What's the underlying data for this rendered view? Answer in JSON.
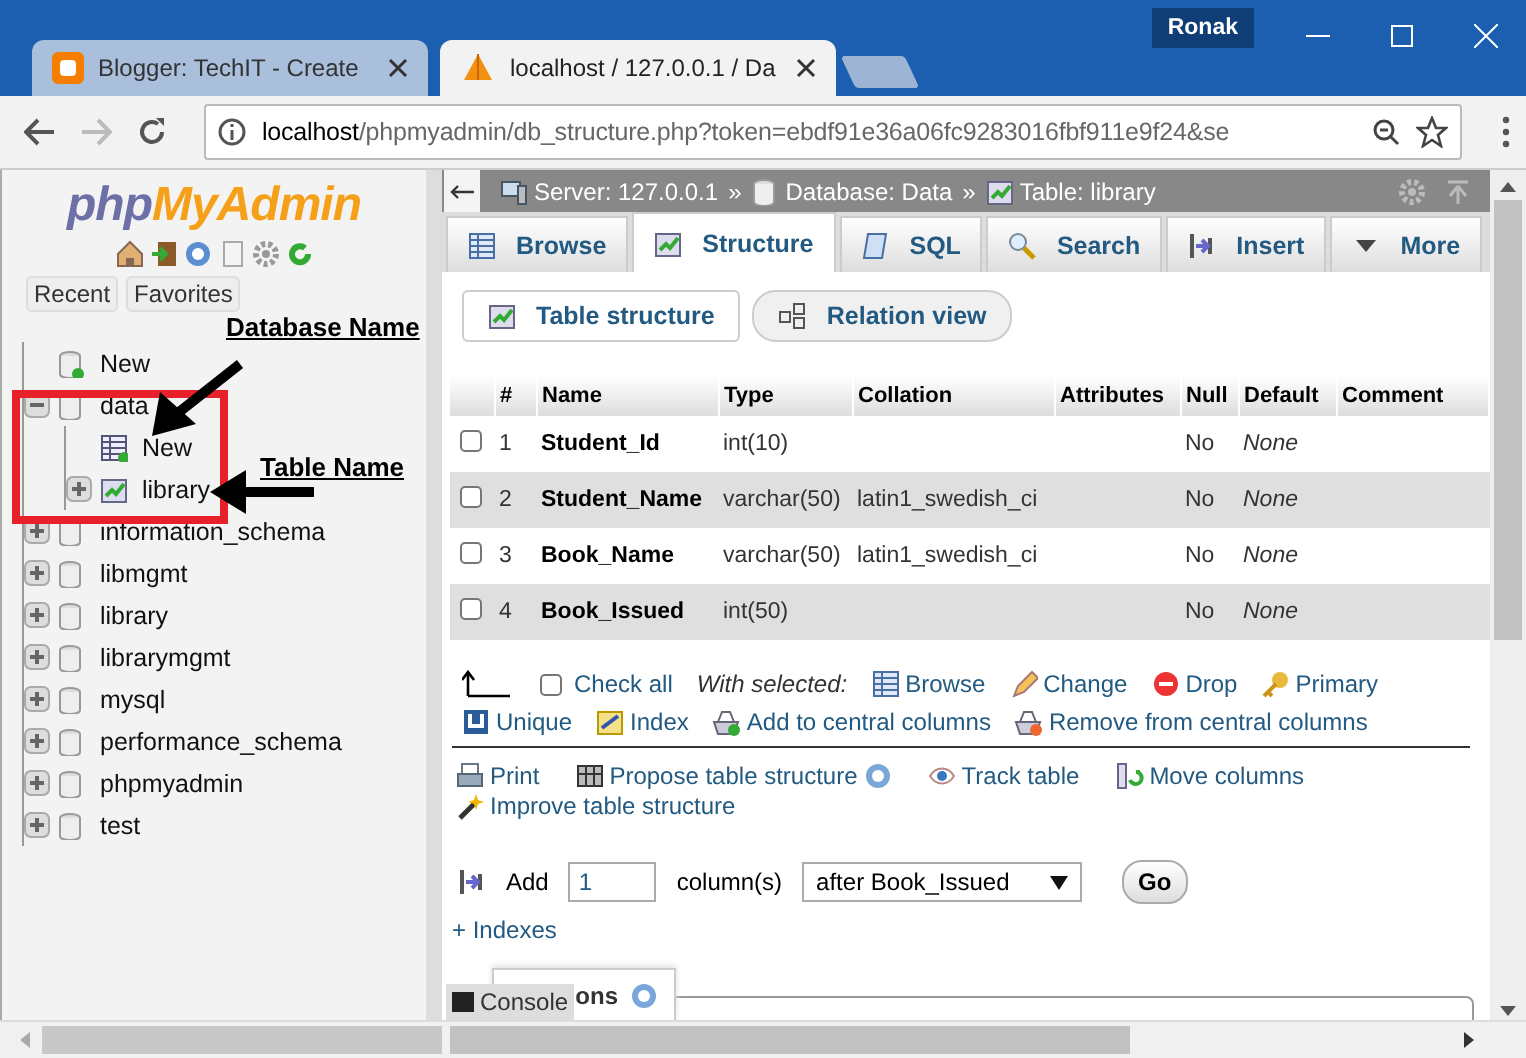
{
  "browser": {
    "tabs": [
      {
        "title": "Blogger: TechIT - Create",
        "kind": "blogger",
        "selected": false
      },
      {
        "title": "localhost / 127.0.0.1 / Da",
        "kind": "pma",
        "selected": true
      }
    ],
    "profile": "Ronak",
    "url": {
      "host": "localhost",
      "path": "/phpmyadmin/db_structure.php?token=ebdf91e36a06fc9283016fbf911e9f24&se"
    }
  },
  "sidebar": {
    "logo": {
      "first": "php",
      "second": "MyAdmin"
    },
    "buttons": [
      "Recent",
      "Favorites"
    ],
    "tree": [
      {
        "label": "New",
        "kind": "new"
      },
      {
        "label": "data",
        "kind": "db",
        "expanded": true,
        "children": [
          {
            "label": "New",
            "kind": "newtable"
          },
          {
            "label": "library",
            "kind": "table",
            "expanded": false
          }
        ]
      },
      {
        "label": "information_schema",
        "kind": "db",
        "expanded": false
      },
      {
        "label": "libmgmt",
        "kind": "db",
        "expanded": false
      },
      {
        "label": "library",
        "kind": "db",
        "expanded": false
      },
      {
        "label": "librarymgmt",
        "kind": "db",
        "expanded": false
      },
      {
        "label": "mysql",
        "kind": "db",
        "expanded": false
      },
      {
        "label": "performance_schema",
        "kind": "db",
        "expanded": false
      },
      {
        "label": "phpmyadmin",
        "kind": "db",
        "expanded": false
      },
      {
        "label": "test",
        "kind": "db",
        "expanded": false
      }
    ]
  },
  "annotations": [
    {
      "text": "Database Name"
    },
    {
      "text": "Table Name"
    }
  ],
  "breadcrumb": {
    "separator": "»",
    "items": [
      {
        "label": "Server: 127.0.0.1",
        "kind": "server"
      },
      {
        "label": "Database: Data",
        "kind": "db"
      },
      {
        "label": "Table: library",
        "kind": "table"
      }
    ]
  },
  "tabs": [
    {
      "label": "Browse",
      "kind": "browse",
      "selected": false
    },
    {
      "label": "Structure",
      "kind": "structure",
      "selected": true
    },
    {
      "label": "SQL",
      "kind": "sql",
      "selected": false
    },
    {
      "label": "Search",
      "kind": "search",
      "selected": false
    },
    {
      "label": "Insert",
      "kind": "insert",
      "selected": false
    },
    {
      "label": "More",
      "kind": "more",
      "selected": false
    }
  ],
  "subtabs": [
    {
      "label": "Table structure",
      "kind": "structure",
      "selected": true
    },
    {
      "label": "Relation view",
      "kind": "relation",
      "selected": false
    }
  ],
  "table": {
    "columns": [
      "#",
      "Name",
      "Type",
      "Collation",
      "Attributes",
      "Null",
      "Default",
      "Comment"
    ],
    "rows": [
      {
        "num": "1",
        "name": "Student_Id",
        "type": "int(10)",
        "collation": "",
        "null": "No",
        "default": "None",
        "checked": false
      },
      {
        "num": "2",
        "name": "Student_Name",
        "type": "varchar(50)",
        "collation": "latin1_swedish_ci",
        "null": "No",
        "default": "None",
        "checked": false
      },
      {
        "num": "3",
        "name": "Book_Name",
        "type": "varchar(50)",
        "collation": "latin1_swedish_ci",
        "null": "No",
        "default": "None",
        "checked": false
      },
      {
        "num": "4",
        "name": "Book_Issued",
        "type": "int(50)",
        "collation": "",
        "null": "No",
        "default": "None",
        "checked": false
      }
    ]
  },
  "bulk": {
    "check_all": "Check all",
    "checked": false,
    "with_selected": "With selected:",
    "actions": [
      {
        "label": "Browse",
        "kind": "browse"
      },
      {
        "label": "Change",
        "kind": "change"
      },
      {
        "label": "Drop",
        "kind": "drop"
      },
      {
        "label": "Primary",
        "kind": "primary"
      },
      {
        "label": "Unique",
        "kind": "unique"
      },
      {
        "label": "Index",
        "kind": "index"
      },
      {
        "label": "Add to central columns",
        "kind": "addcentral"
      },
      {
        "label": "Remove from central columns",
        "kind": "removecentral"
      }
    ]
  },
  "tools": [
    {
      "label": "Print",
      "kind": "print"
    },
    {
      "label": "Propose table structure",
      "kind": "propose",
      "help": true
    },
    {
      "label": "Track table",
      "kind": "track"
    },
    {
      "label": "Move columns",
      "kind": "move"
    },
    {
      "label": "Improve table structure",
      "kind": "improve"
    }
  ],
  "add_columns": {
    "label": "Add",
    "value": "1",
    "unit": "column(s)",
    "position": "after Book_Issued",
    "button": "Go"
  },
  "indexes_link": "+ Indexes",
  "section_title": "ons",
  "console": "Console"
}
